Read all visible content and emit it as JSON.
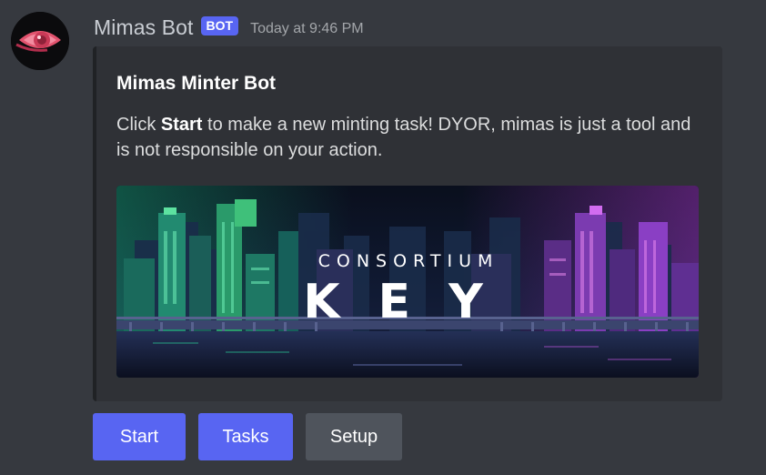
{
  "author": {
    "username": "Mimas Bot",
    "bot_tag": "BOT",
    "timestamp": "Today at 9:46 PM",
    "avatar_icon": "pink-eye-icon"
  },
  "embed": {
    "title": "Mimas Minter Bot",
    "description_prefix": "Click ",
    "description_bold": "Start",
    "description_suffix": " to make a new minting task! DYOR, mimas is just a tool and is not responsible on your action.",
    "image": {
      "subtitle": "CONSORTIUM",
      "title": "KEY"
    }
  },
  "buttons": [
    {
      "label": "Start",
      "style": "primary"
    },
    {
      "label": "Tasks",
      "style": "primary"
    },
    {
      "label": "Setup",
      "style": "secondary"
    }
  ],
  "colors": {
    "background": "#36393f",
    "embed_background": "#2f3136",
    "blurple": "#5865f2",
    "secondary_button": "#4f545c"
  }
}
